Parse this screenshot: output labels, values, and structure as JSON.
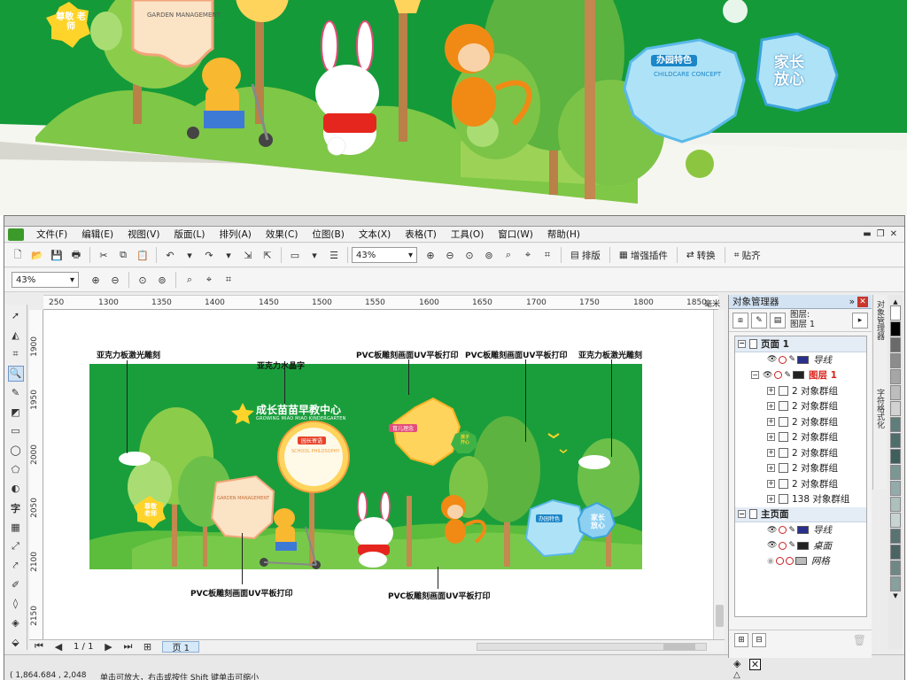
{
  "banner": {
    "badge_left": "尊敬\n老师",
    "card_left_title": "GARDEN MANAGEMENT",
    "card_right_title": "办园特色",
    "card_right_subtitle": "CHILDCARE CONCEPT",
    "badge_right": "家长\n放心"
  },
  "app": {
    "menu": [
      "文件(F)",
      "编辑(E)",
      "视图(V)",
      "版面(L)",
      "排列(A)",
      "效果(C)",
      "位图(B)",
      "文本(X)",
      "表格(T)",
      "工具(O)",
      "窗口(W)",
      "帮助(H)"
    ],
    "toolbar": {
      "zoom_main": "43%",
      "text_buttons": [
        "排版",
        "增强插件",
        "转换",
        "贴齐"
      ]
    },
    "toolbar2": {
      "zoom_secondary": "43%"
    },
    "ruler": {
      "h_ticks": [
        "250",
        "1300",
        "1350",
        "1400",
        "1450",
        "1500",
        "1550",
        "1600",
        "1650",
        "1700",
        "1750",
        "1800",
        "1850"
      ],
      "unit": "毫米",
      "v_ticks": [
        "1900",
        "1950",
        "2000",
        "2050",
        "2100",
        "2150"
      ]
    },
    "canvas": {
      "annotations": [
        "亚克力板激光雕刻",
        "亚克力水晶字",
        "PVC板雕刻画面UV平板打印",
        "PVC板雕刻画面UV平板打印",
        "亚克力板激光雕刻",
        "PVC板雕刻画面UV平板打印",
        "PVC板雕刻画面UV平板打印"
      ],
      "design": {
        "logo_title": "成长苗苗早教中心",
        "logo_subtitle": "GROWING MIAO MIAO KINDERGARTEN",
        "card_yellow_title": "园长寄语",
        "card_pink_title": "SCHOOL PHILOSOPHY",
        "card_peach_title": "GARDEN MANAGEMENT",
        "card_star_title": "育儿理念",
        "card_blue_title": "办园特色",
        "badge_teacher": "尊敬\n老师",
        "badge_parent": "家长\n放心",
        "badge_small": "孩子\n开心"
      }
    },
    "page_nav": {
      "page_count": "1 / 1",
      "page_tab": "页 1"
    },
    "status": {
      "coords": "( 1,864.684 , 2,048",
      "hint": "单击可放大，右击或按住 Shift 键单击可缩小"
    },
    "docker": {
      "title": "对象管理器",
      "current_page": "图层:",
      "current_layer": "图层 1",
      "tree": [
        {
          "kind": "page",
          "label": "页面 1"
        },
        {
          "kind": "layer",
          "label": "导线",
          "color": "#2a2f8c",
          "italic": true
        },
        {
          "kind": "layer",
          "label": "图层 1",
          "color": "#222222",
          "active": true
        },
        {
          "kind": "group",
          "label": "2 对象群组"
        },
        {
          "kind": "group",
          "label": "2 对象群组"
        },
        {
          "kind": "group",
          "label": "2 对象群组"
        },
        {
          "kind": "group",
          "label": "2 对象群组"
        },
        {
          "kind": "group",
          "label": "2 对象群组"
        },
        {
          "kind": "group",
          "label": "2 对象群组"
        },
        {
          "kind": "group",
          "label": "2 对象群组"
        },
        {
          "kind": "group",
          "label": "138 对象群组"
        },
        {
          "kind": "page",
          "label": "主页面"
        },
        {
          "kind": "layer",
          "label": "导线",
          "color": "#2a2f8c",
          "italic": true
        },
        {
          "kind": "layer",
          "label": "桌面",
          "color": "#222222",
          "italic": true
        },
        {
          "kind": "layer",
          "label": "网格",
          "color": "#bbbbbb",
          "italic": true
        }
      ],
      "vtabs": [
        "对象管理器",
        "字符格式化"
      ]
    },
    "palette": [
      "#ffffff",
      "#000000",
      "#00a8e6",
      "#ff0000",
      "#00a651",
      "#ffff00",
      "#2e3192",
      "#ec008c",
      "#f7941d",
      "#8dc63f",
      "#1b1464",
      "#754c24",
      "#cccccc",
      "#999999",
      "#666666",
      "#333333",
      "#00aeef",
      "#ed1c24",
      "#39b54a",
      "#fff200",
      "#662d91"
    ],
    "colors": {
      "wall_green": "#149a39",
      "design_green": "#1a9e3c",
      "tree_green": "#6cc04a",
      "accent_red": "#d9221b"
    }
  }
}
